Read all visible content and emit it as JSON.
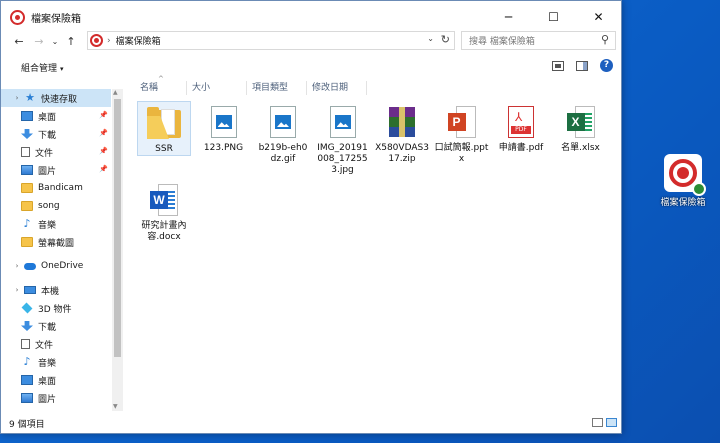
{
  "window": {
    "title": "檔案保險箱",
    "controls": {
      "minimize": "─",
      "maximize": "☐",
      "close": "✕"
    }
  },
  "nav": {
    "back": "←",
    "forward": "→",
    "recent": "⌄",
    "up": "↑",
    "address_sep": "›",
    "address": "檔案保險箱",
    "address_dropdown": "⌄",
    "refresh": "↻",
    "search_placeholder": "搜尋 檔案保險箱",
    "search_icon": "⚲"
  },
  "command_bar": {
    "organize": "組合管理",
    "organize_caret": "▾",
    "help": "?"
  },
  "sidebar": {
    "quick_access": {
      "label": "快速存取",
      "icon": "star-icon",
      "items": [
        {
          "label": "桌面",
          "icon": "desktop-icon",
          "pinned": true
        },
        {
          "label": "下載",
          "icon": "download-icon",
          "pinned": true
        },
        {
          "label": "文件",
          "icon": "document-icon",
          "pinned": true
        },
        {
          "label": "圖片",
          "icon": "pictures-icon",
          "pinned": true
        },
        {
          "label": "Bandicam",
          "icon": "folder-icon",
          "pinned": false
        },
        {
          "label": "song",
          "icon": "folder-icon",
          "pinned": false
        },
        {
          "label": "音樂",
          "icon": "music-icon",
          "pinned": false
        },
        {
          "label": "螢幕截圖",
          "icon": "folder-icon",
          "pinned": false
        }
      ]
    },
    "onedrive": {
      "label": "OneDrive",
      "icon": "cloud-icon"
    },
    "this_pc": {
      "label": "本機",
      "icon": "computer-icon",
      "items": [
        {
          "label": "3D 物件",
          "icon": "cube-icon"
        },
        {
          "label": "下載",
          "icon": "download-icon"
        },
        {
          "label": "文件",
          "icon": "document-icon"
        },
        {
          "label": "音樂",
          "icon": "music-icon"
        },
        {
          "label": "桌面",
          "icon": "desktop-icon"
        },
        {
          "label": "圖片",
          "icon": "pictures-icon"
        }
      ]
    },
    "pin_glyph": "📌"
  },
  "columns": [
    "名稱",
    "大小",
    "項目類型",
    "修改日期"
  ],
  "sort_glyph": "^",
  "files": [
    {
      "name": "SSR",
      "type": "folder",
      "selected": true
    },
    {
      "name": "123.PNG",
      "type": "image"
    },
    {
      "name": "b219b-eh0dz.gif",
      "type": "image"
    },
    {
      "name": "IMG_20191008_172553.jpg",
      "type": "image"
    },
    {
      "name": "X580VDAS317.zip",
      "type": "rar"
    },
    {
      "name": "口試簡報.pptx",
      "type": "ppt",
      "badge": "P"
    },
    {
      "name": "申請書.pdf",
      "type": "pdf",
      "label": "PDF"
    },
    {
      "name": "名單.xlsx",
      "type": "xls",
      "badge": "X"
    },
    {
      "name": "研究計畫內容.docx",
      "type": "doc",
      "badge": "W"
    }
  ],
  "status": {
    "text": "9 個項目"
  },
  "desktop_icon": {
    "label": "檔案保險箱"
  },
  "colors": {
    "accent": "#0078d7",
    "selection": "#cce4f7",
    "brand_red": "#d32b2b"
  }
}
